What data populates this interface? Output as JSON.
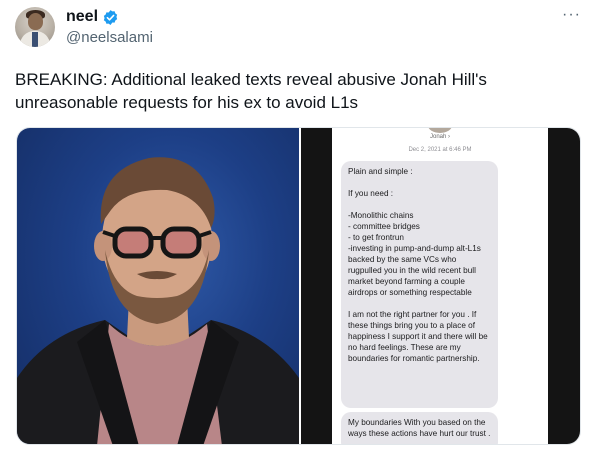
{
  "author": {
    "name": "neel",
    "handle": "@neelsalami",
    "verified_color": "#1d9bf0"
  },
  "header": {
    "more_label": "···"
  },
  "tweet": {
    "text": "BREAKING: Additional leaked texts reveal abusive Jonah Hill's unreasonable requests for his ex to avoid L1s"
  },
  "screenshot": {
    "contact": "Jonah ›",
    "timestamp": "Dec 2, 2021 at 6:46 PM",
    "messages": [
      "Plain and simple :\n\nIf you need :\n\n-Monolithic chains\n- committee bridges\n- to get frontrun\n-investing in pump-and-dump alt-L1s backed by the same VCs who rugpulled you in the wild recent bull market beyond farming a couple airdrops or something respectable\n\nI am not the right partner for you . If these things bring you to a place of happiness I support it and there will be no hard feelings. These are my boundaries for romantic partnership.",
      "My boundaries With you based on the ways these actions have hurt our trust ."
    ]
  },
  "colors": {
    "text_primary": "#0f1419",
    "text_secondary": "#536471",
    "photo_background": "#1d3f86",
    "bubble_gray": "#e6e5ea"
  }
}
